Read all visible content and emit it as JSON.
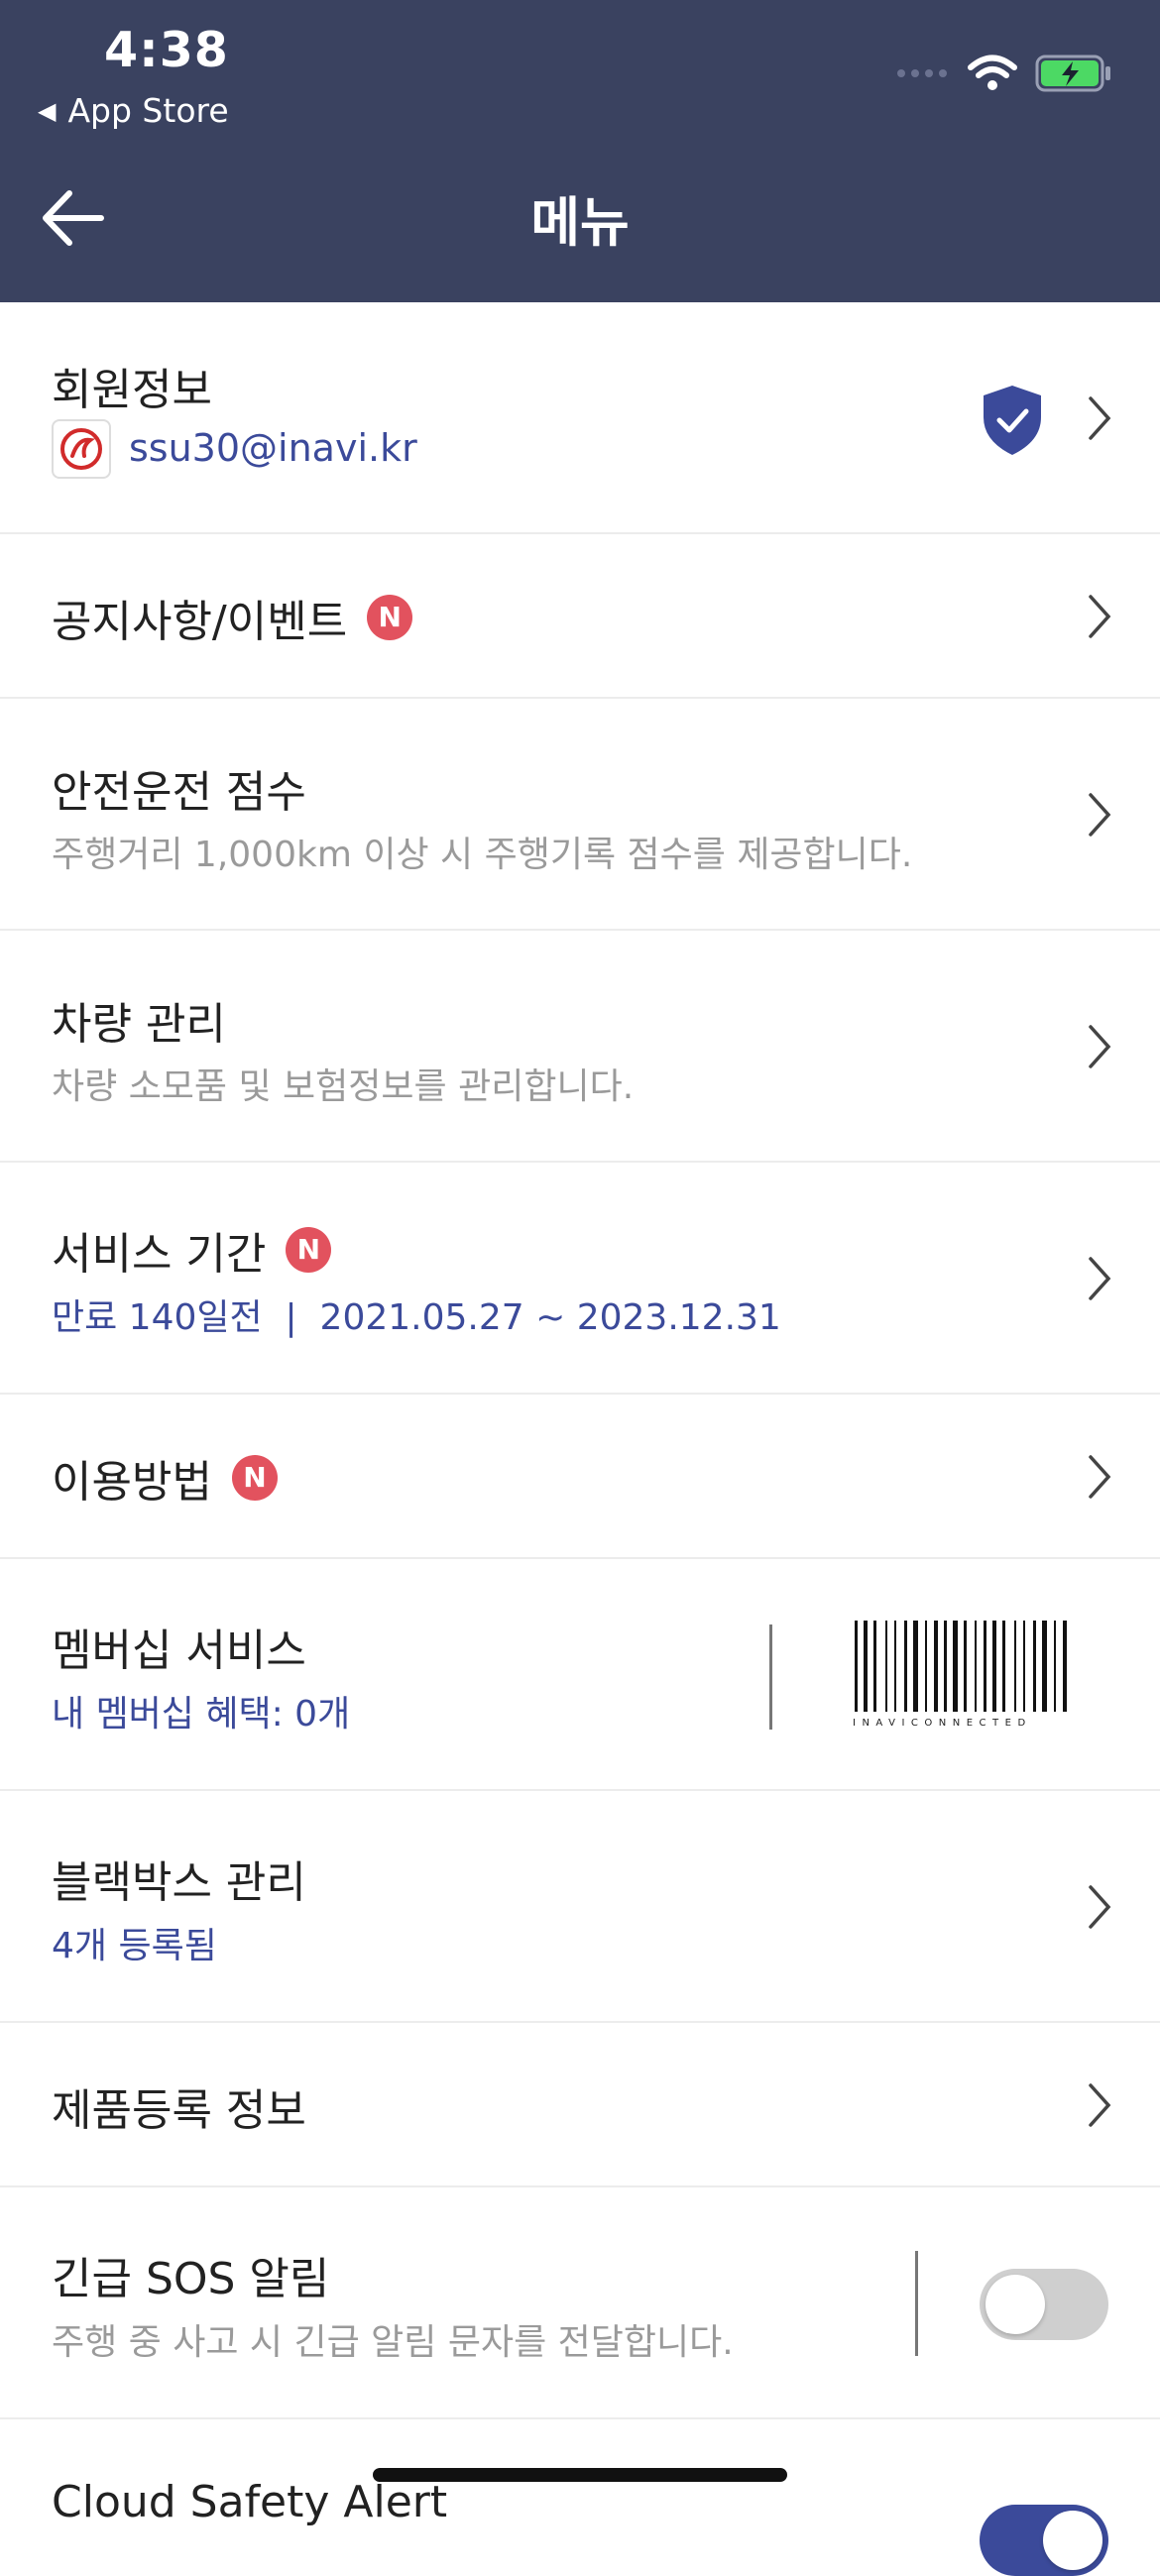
{
  "status_bar": {
    "time": "4:38",
    "back_app": "App Store",
    "icons": [
      "signal-icon",
      "wifi-icon",
      "battery-charging-icon"
    ]
  },
  "header": {
    "title": "메뉴",
    "back_icon": "back-arrow-icon"
  },
  "colors": {
    "header_bg": "#3a4260",
    "accent_blue": "#3b4a9a",
    "badge_red": "#e2525e"
  },
  "menu": {
    "member": {
      "label": "회원정보",
      "email": "ssu30@inavi.kr"
    },
    "notice": {
      "label": "공지사항/이벤트",
      "badge": "N"
    },
    "safety": {
      "label": "안전운전 점수",
      "sub": "주행거리 1,000km 이상 시 주행기록 점수를 제공합니다."
    },
    "vehicle": {
      "label": "차량 관리",
      "sub": "차량 소모품 및 보험정보를 관리합니다."
    },
    "service": {
      "label": "서비스 기간",
      "badge": "N",
      "sub": "만료 140일전  |  2021.05.27 ~ 2023.12.31"
    },
    "howto": {
      "label": "이용방법",
      "badge": "N"
    },
    "membership": {
      "label": "멤버십 서비스",
      "sub": "내 멤버십 혜택: 0개",
      "barcode_text": "INAVICONNECTED"
    },
    "blackbox": {
      "label": "블랙박스 관리",
      "sub": "4개 등록됨"
    },
    "product": {
      "label": "제품등록 정보"
    },
    "sos": {
      "label": "긴급 SOS 알림",
      "sub": "주행 중 사고 시 긴급 알림 문자를 전달합니다.",
      "enabled": false
    },
    "cloud": {
      "label": "Cloud Safety Alert",
      "enabled": true
    }
  }
}
